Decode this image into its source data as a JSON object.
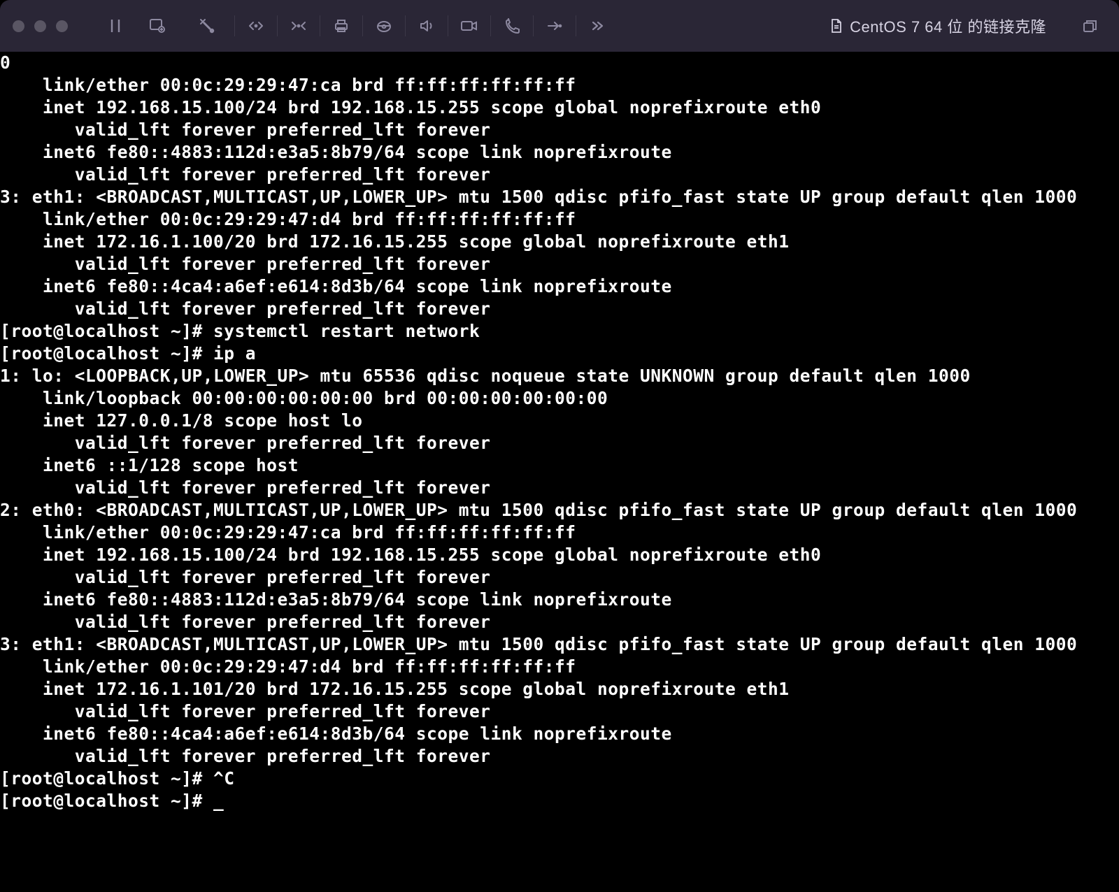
{
  "window": {
    "title": "CentOS 7 64 位 的链接克隆"
  },
  "terminal": {
    "lines": [
      "0",
      "    link/ether 00:0c:29:29:47:ca brd ff:ff:ff:ff:ff:ff",
      "    inet 192.168.15.100/24 brd 192.168.15.255 scope global noprefixroute eth0",
      "       valid_lft forever preferred_lft forever",
      "    inet6 fe80::4883:112d:e3a5:8b79/64 scope link noprefixroute",
      "       valid_lft forever preferred_lft forever",
      "3: eth1: <BROADCAST,MULTICAST,UP,LOWER_UP> mtu 1500 qdisc pfifo_fast state UP group default qlen 1000",
      "    link/ether 00:0c:29:29:47:d4 brd ff:ff:ff:ff:ff:ff",
      "    inet 172.16.1.100/20 brd 172.16.15.255 scope global noprefixroute eth1",
      "       valid_lft forever preferred_lft forever",
      "    inet6 fe80::4ca4:a6ef:e614:8d3b/64 scope link noprefixroute",
      "       valid_lft forever preferred_lft forever",
      "[root@localhost ~]# systemctl restart network",
      "[root@localhost ~]# ip a",
      "1: lo: <LOOPBACK,UP,LOWER_UP> mtu 65536 qdisc noqueue state UNKNOWN group default qlen 1000",
      "    link/loopback 00:00:00:00:00:00 brd 00:00:00:00:00:00",
      "    inet 127.0.0.1/8 scope host lo",
      "       valid_lft forever preferred_lft forever",
      "    inet6 ::1/128 scope host",
      "       valid_lft forever preferred_lft forever",
      "2: eth0: <BROADCAST,MULTICAST,UP,LOWER_UP> mtu 1500 qdisc pfifo_fast state UP group default qlen 1000",
      "    link/ether 00:0c:29:29:47:ca brd ff:ff:ff:ff:ff:ff",
      "    inet 192.168.15.100/24 brd 192.168.15.255 scope global noprefixroute eth0",
      "       valid_lft forever preferred_lft forever",
      "    inet6 fe80::4883:112d:e3a5:8b79/64 scope link noprefixroute",
      "       valid_lft forever preferred_lft forever",
      "3: eth1: <BROADCAST,MULTICAST,UP,LOWER_UP> mtu 1500 qdisc pfifo_fast state UP group default qlen 1000",
      "    link/ether 00:0c:29:29:47:d4 brd ff:ff:ff:ff:ff:ff",
      "    inet 172.16.1.101/20 brd 172.16.15.255 scope global noprefixroute eth1",
      "       valid_lft forever preferred_lft forever",
      "    inet6 fe80::4ca4:a6ef:e614:8d3b/64 scope link noprefixroute",
      "       valid_lft forever preferred_lft forever",
      "[root@localhost ~]# ^C",
      "[root@localhost ~]# "
    ],
    "cursor_on_last_line": true
  }
}
